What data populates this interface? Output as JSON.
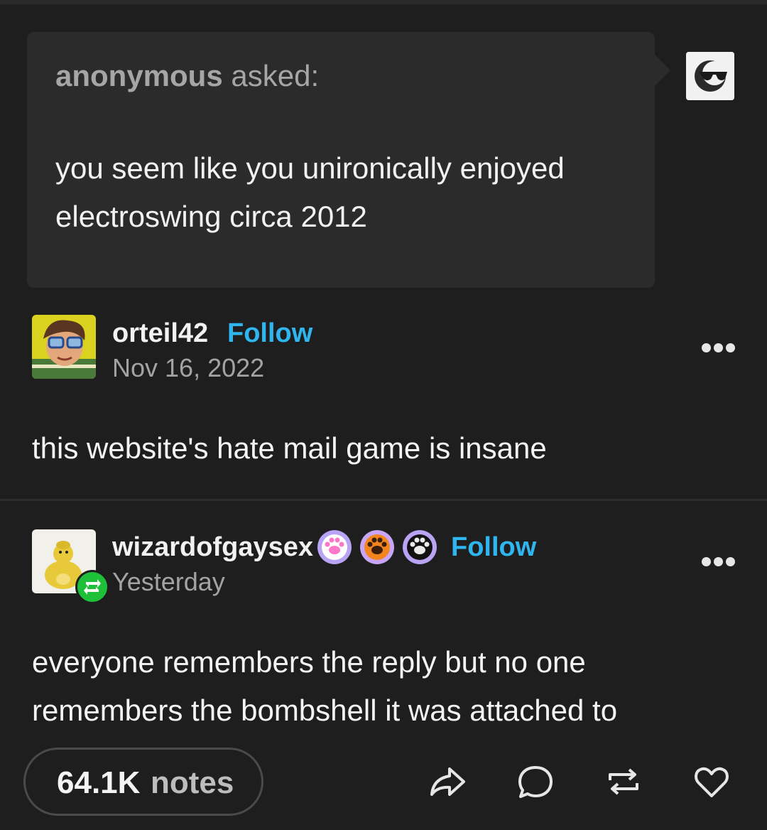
{
  "ask": {
    "asker": "anonymous",
    "asked_label": "asked:",
    "question": "you seem like you unironically enjoyed electroswing circa 2012"
  },
  "post1": {
    "username": "orteil42",
    "follow_label": "Follow",
    "date": "Nov 16, 2022",
    "body": "this website's hate mail game is insane"
  },
  "post2": {
    "username": "wizardofgaysex",
    "follow_label": "Follow",
    "date": "Yesterday",
    "body": "everyone remembers the reply but no one remembers the bombshell it was attached to",
    "badges": [
      "pink-paw-badge",
      "orange-paw-badge",
      "black-paw-badge"
    ]
  },
  "footer": {
    "notes_count": "64.1K",
    "notes_label": "notes",
    "actions": [
      "share-icon",
      "reply-icon",
      "reblog-icon",
      "like-icon"
    ]
  },
  "colors": {
    "background": "#1e1e1e",
    "ask_bubble": "#2b2b2b",
    "follow": "#2fb6ef",
    "reblog_green": "#1ec03a"
  }
}
